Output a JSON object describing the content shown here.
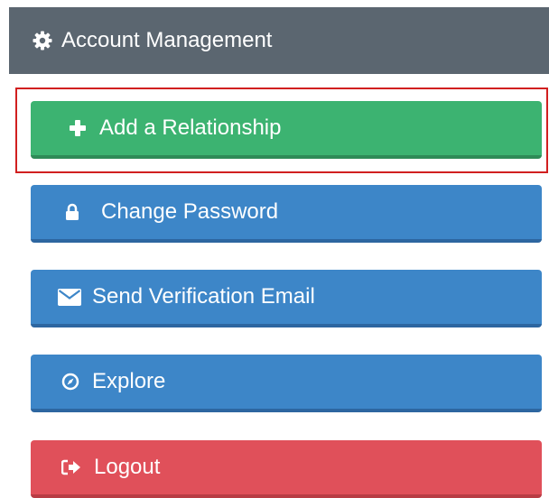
{
  "header": {
    "title": "Account Management",
    "icon": "gear-icon"
  },
  "colors": {
    "header_bg": "#5b6670",
    "success": "#3cb371",
    "primary": "#3d86c8",
    "danger": "#e0505a",
    "highlight_border": "#d11f1f"
  },
  "buttons": [
    {
      "label": "Add a Relationship",
      "icon": "plus-icon",
      "style": "success",
      "highlighted": true
    },
    {
      "label": "Change Password",
      "icon": "lock-icon",
      "style": "primary"
    },
    {
      "label": "Send Verification Email",
      "icon": "envelope-icon",
      "style": "primary"
    },
    {
      "label": "Explore",
      "icon": "compass-icon",
      "style": "primary"
    },
    {
      "label": "Logout",
      "icon": "sign-out-icon",
      "style": "danger"
    }
  ]
}
